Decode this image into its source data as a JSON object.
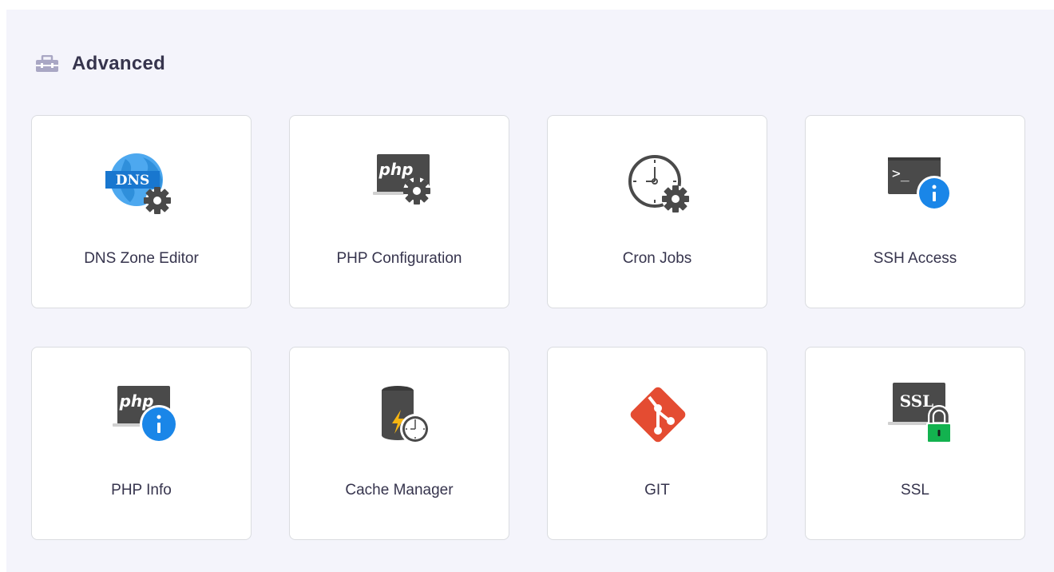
{
  "section": {
    "title": "Advanced",
    "icon": "toolbox-icon"
  },
  "cards": [
    {
      "label": "DNS Zone Editor",
      "icon": "dns-gear-icon",
      "badge": "DNS"
    },
    {
      "label": "PHP Configuration",
      "icon": "php-gear-icon",
      "badge": "php"
    },
    {
      "label": "Cron Jobs",
      "icon": "clock-gear-icon"
    },
    {
      "label": "SSH Access",
      "icon": "terminal-info-icon",
      "badge": ">_"
    },
    {
      "label": "PHP Info",
      "icon": "php-info-icon",
      "badge": "php"
    },
    {
      "label": "Cache Manager",
      "icon": "database-lightning-clock-icon"
    },
    {
      "label": "GIT",
      "icon": "git-icon"
    },
    {
      "label": "SSL",
      "icon": "ssl-lock-icon",
      "badge": "SSL"
    }
  ],
  "colors": {
    "panel_bg": "#f4f4fb",
    "title": "#36344d",
    "dark_gray": "#4a4a4a",
    "gear": "#4a4a4a",
    "info_blue": "#1a86e8",
    "globe_blue": "#4da8ef",
    "git_red": "#e44c32",
    "lock_green": "#13b24f",
    "lightning": "#f6b512"
  }
}
